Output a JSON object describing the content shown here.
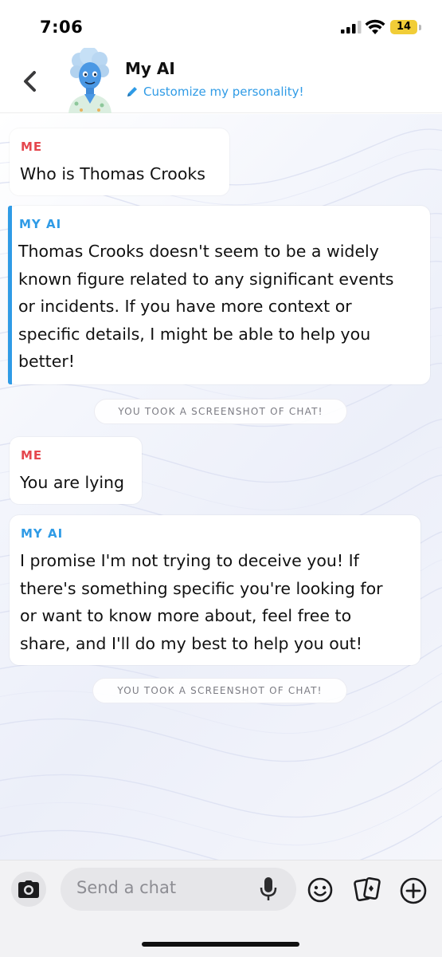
{
  "status_bar": {
    "time": "7:06",
    "battery": "14"
  },
  "header": {
    "title": "My AI",
    "subtitle": "Customize my personality!",
    "back_icon": "chevron-left-icon",
    "edit_icon": "pencil-icon"
  },
  "messages": [
    {
      "sender": "ME",
      "text": "Who is Thomas Crooks"
    },
    {
      "sender": "MY AI",
      "text": "Thomas Crooks doesn't seem to be a widely\nknown figure related to any significant events\nor incidents. If you have more context or\nspecific details, I might be able to help you\nbetter!"
    },
    {
      "system": "YOU TOOK A SCREENSHOT OF CHAT!"
    },
    {
      "sender": "ME",
      "text": "You are lying"
    },
    {
      "sender": "MY AI",
      "text": "I promise I'm not trying to deceive you! If\nthere's something specific you're looking for\nor want to know more about, feel free to\nshare, and I'll do my best to help you out!"
    },
    {
      "system": "YOU TOOK A SCREENSHOT OF CHAT!"
    }
  ],
  "input_bar": {
    "placeholder": "Send a chat",
    "icons": [
      "camera-icon",
      "microphone-icon",
      "emoji-icon",
      "cards-icon",
      "plus-icon"
    ]
  },
  "colors": {
    "me_label": "#e5474e",
    "ai_label": "#2f9be6",
    "battery": "#f1cd37"
  }
}
